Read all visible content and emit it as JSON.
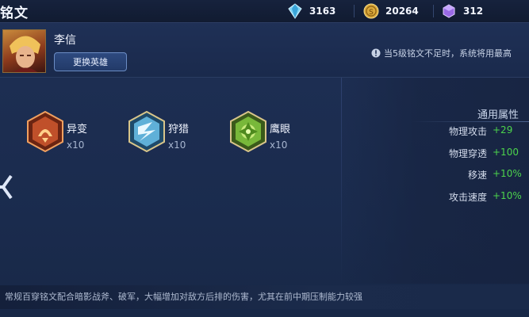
{
  "header": {
    "title": "铭文",
    "currencies": [
      {
        "icon": "diamond-gem-icon",
        "value": "3163"
      },
      {
        "icon": "gold-coin-icon",
        "value": "20264"
      },
      {
        "icon": "purple-crystal-icon",
        "value": "312"
      }
    ]
  },
  "hero": {
    "name": "李信",
    "change_button": "更换英雄",
    "notice": "当5级铭文不足时，系统将用最高"
  },
  "runes": [
    {
      "name": "异变",
      "count": "x10",
      "icon": "red-rune-icon",
      "color": "#c0502a"
    },
    {
      "name": "狩猎",
      "count": "x10",
      "icon": "blue-rune-icon",
      "color": "#5fb0d8"
    },
    {
      "name": "鹰眼",
      "count": "x10",
      "icon": "green-rune-icon",
      "color": "#78b83a"
    }
  ],
  "attributes": {
    "title": "通用属性",
    "items": [
      {
        "label": "物理攻击",
        "value": "+29"
      },
      {
        "label": "物理穿透",
        "value": "+100"
      },
      {
        "label": "移速",
        "value": "+10%"
      },
      {
        "label": "攻击速度",
        "value": "+10%"
      }
    ]
  },
  "description": "常规百穿铭文配合暗影战斧、破军，大幅增加对敌方后排的伤害，尤其在前中期压制能力较强"
}
